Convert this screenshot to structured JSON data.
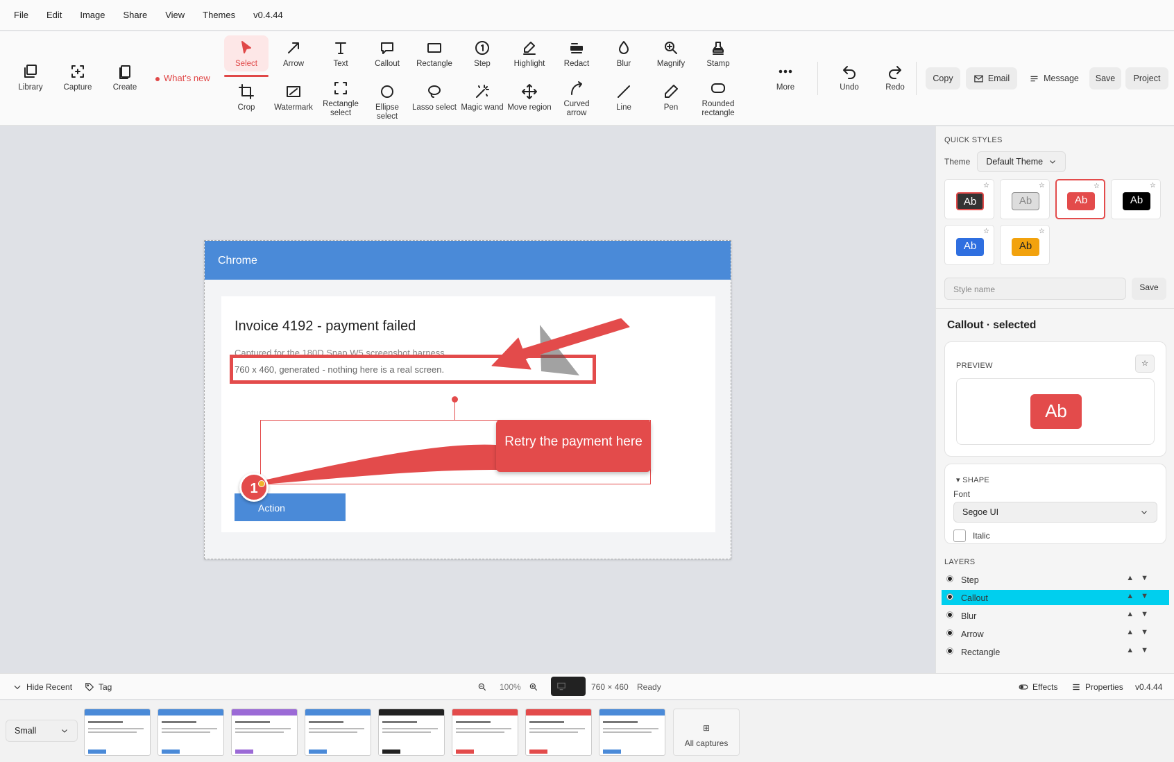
{
  "menu": [
    "File",
    "Edit",
    "Image",
    "Share",
    "View",
    "Themes",
    "v0.4.44"
  ],
  "toolbar": {
    "left": [
      {
        "label": "Library",
        "icon": "library-icon"
      },
      {
        "label": "Capture",
        "icon": "capture-icon"
      },
      {
        "label": "Create",
        "icon": "create-icon"
      }
    ],
    "whats_new": "What's new",
    "tools_row1": [
      {
        "label": "Select",
        "icon": "select-icon",
        "selected": true
      },
      {
        "label": "Arrow",
        "icon": "arrow-icon"
      },
      {
        "label": "Text",
        "icon": "text-icon"
      },
      {
        "label": "Callout",
        "icon": "callout-icon"
      },
      {
        "label": "Rectangle",
        "icon": "rectangle-icon"
      },
      {
        "label": "Step",
        "icon": "step-icon"
      },
      {
        "label": "Highlight",
        "icon": "highlight-icon"
      },
      {
        "label": "Redact",
        "icon": "redact-icon"
      },
      {
        "label": "Blur",
        "icon": "blur-icon"
      },
      {
        "label": "Magnify",
        "icon": "magnify-icon"
      },
      {
        "label": "Stamp",
        "icon": "stamp-icon"
      }
    ],
    "tools_row2": [
      {
        "label": "Crop",
        "icon": "crop-icon"
      },
      {
        "label": "Watermark",
        "icon": "watermark-icon"
      },
      {
        "label": "Rectangle select",
        "icon": "rectangle-select-icon"
      },
      {
        "label": "Ellipse select",
        "icon": "ellipse-select-icon"
      },
      {
        "label": "Lasso select",
        "icon": "lasso-select-icon"
      },
      {
        "label": "Magic wand",
        "icon": "magic-wand-icon"
      },
      {
        "label": "Move region",
        "icon": "move-region-icon"
      },
      {
        "label": "Curved arrow",
        "icon": "curved-arrow-icon"
      },
      {
        "label": "Line",
        "icon": "line-icon"
      },
      {
        "label": "Pen",
        "icon": "pen-icon"
      },
      {
        "label": "Rounded rectangle",
        "icon": "rounded-rectangle-icon"
      }
    ],
    "more": "More",
    "undo": "Undo",
    "redo": "Redo",
    "actions": [
      "Copy",
      "Email",
      "Message",
      "Save",
      "Project"
    ]
  },
  "canvas": {
    "window_title": "Chrome",
    "invoice_title": "Invoice 4192 - payment failed",
    "subtitle": "Captured for the 180D Snap W5 screenshot harness",
    "line2": "760 x 460, generated - nothing here is a real screen.",
    "action_button": "Action",
    "callout_text": "Retry the payment here",
    "step_number": "1"
  },
  "panel": {
    "quick_styles": "QUICK STYLES",
    "theme_label": "Theme",
    "theme_value": "Default Theme",
    "swatch_text": "Ab",
    "style_name_placeholder": "Style name",
    "save": "Save",
    "selected_title": "Callout · selected",
    "preview": "PREVIEW",
    "preview_text": "Ab",
    "shape": "SHAPE",
    "font_label": "Font",
    "font_value": "Segoe UI",
    "italic": "Italic",
    "layers_title": "LAYERS",
    "layers": [
      {
        "name": "Step",
        "selected": false
      },
      {
        "name": "Callout",
        "selected": true
      },
      {
        "name": "Blur",
        "selected": false
      },
      {
        "name": "Arrow",
        "selected": false
      },
      {
        "name": "Rectangle",
        "selected": false
      }
    ]
  },
  "status": {
    "hide_recent": "Hide Recent",
    "tag": "Tag",
    "zoom": "100%",
    "dimensions": "760 × 460",
    "state": "Ready",
    "effects": "Effects",
    "properties": "Properties",
    "version": "v0.4.44"
  },
  "recent": {
    "size": "Small",
    "all_captures": "All captures"
  },
  "colors": {
    "accent": "#e34b4b",
    "chrome_blue": "#4a8ad8",
    "layer_selected": "#00cfee"
  }
}
